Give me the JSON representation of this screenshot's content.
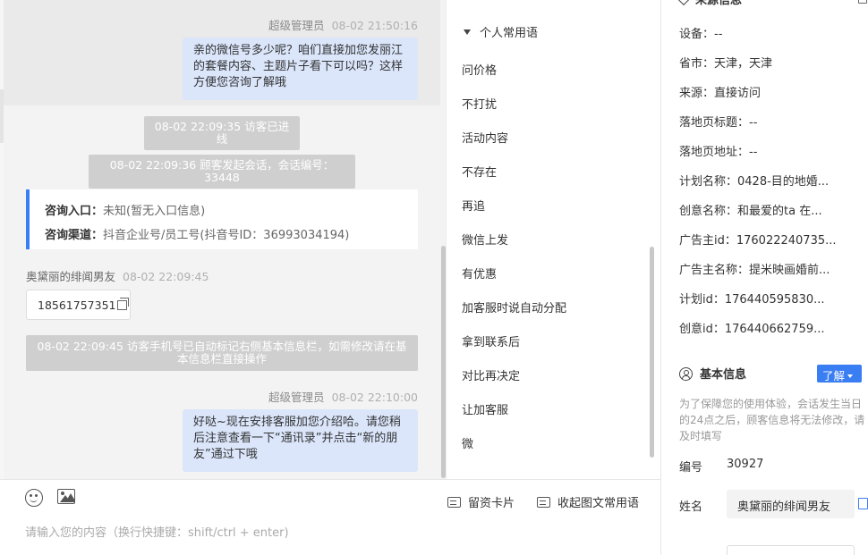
{
  "chat": {
    "messages": [
      {
        "sender": "超级管理员",
        "time": "08-02 21:50:16",
        "lines": [
          "亲的微信号多少呢？咱们直接加您发丽江",
          "的套餐内容、主题片子看下可以吗？这样",
          "方便您咨询了解哦"
        ]
      },
      {
        "sender": "超级管理员",
        "time": "08-02 22:10:00",
        "lines": [
          "好哒~现在安排客服加您介绍哈。请您稍",
          "后注意查看一下“通讯录”并点击“新的朋",
          "友”通过下哦"
        ]
      }
    ],
    "system": {
      "s1": "08-02 22:09:35 访客已进线",
      "s2": "08-02 22:09:36 顾客发起会话，会话编号：33448",
      "s3": [
        "08-02 22:09:45 访客手机号已自动标记右侧基本信息栏，如需修改请在基",
        "本信息栏直接操作"
      ]
    },
    "info_card": {
      "entry_label": "咨询入口：",
      "entry_value": "未知(暂无入口信息)",
      "channel_label": "咨询渠道：",
      "channel_value": "抖音企业号/员工号(抖音号ID：36993034194)"
    },
    "visitor": {
      "name": "奥黛丽的绯闻男友",
      "time": "08-02 22:09:45",
      "phone": "18561757351"
    }
  },
  "input": {
    "placeholder": "请输入您的内容（换行快捷键：shift/ctrl + enter)",
    "lead_card": "留资卡片",
    "collapse": "收起图文常用语"
  },
  "phrases": {
    "group": "个人常用语",
    "items": [
      "问价格",
      "不打扰",
      "活动内容",
      "不存在",
      "再追",
      "微信上发",
      "有优惠",
      "加客服时说自动分配",
      "拿到联系后",
      "对比再决定",
      "让加客服",
      "微"
    ]
  },
  "source_info": {
    "title": "来源信息",
    "rows": [
      "设备：--",
      "省市：天津，天津",
      "来源：直接访问",
      "落地页标题：--",
      "落地页地址：--",
      "计划名称：0428-目的地婚...",
      "创意名称：和最爱的ta 在...",
      "广告主id：176022240735...",
      "广告主名称：提米映画婚前...",
      "计划id：176440595830...",
      "创意id：176440662759..."
    ]
  },
  "basic_info": {
    "title": "基本信息",
    "learn": "了解",
    "notice": "为了保障您的使用体验，会话发生当日的24点之后，顾客信息将无法修改，请及时填写",
    "id_label": "编号",
    "id_value": "30927",
    "name_label": "姓名",
    "name_value": "奥黛丽的绯闻男友"
  },
  "colors": {
    "accent": "#3a7ef3",
    "bubble": "#dbe6fb",
    "system": "#cfcfcf"
  }
}
